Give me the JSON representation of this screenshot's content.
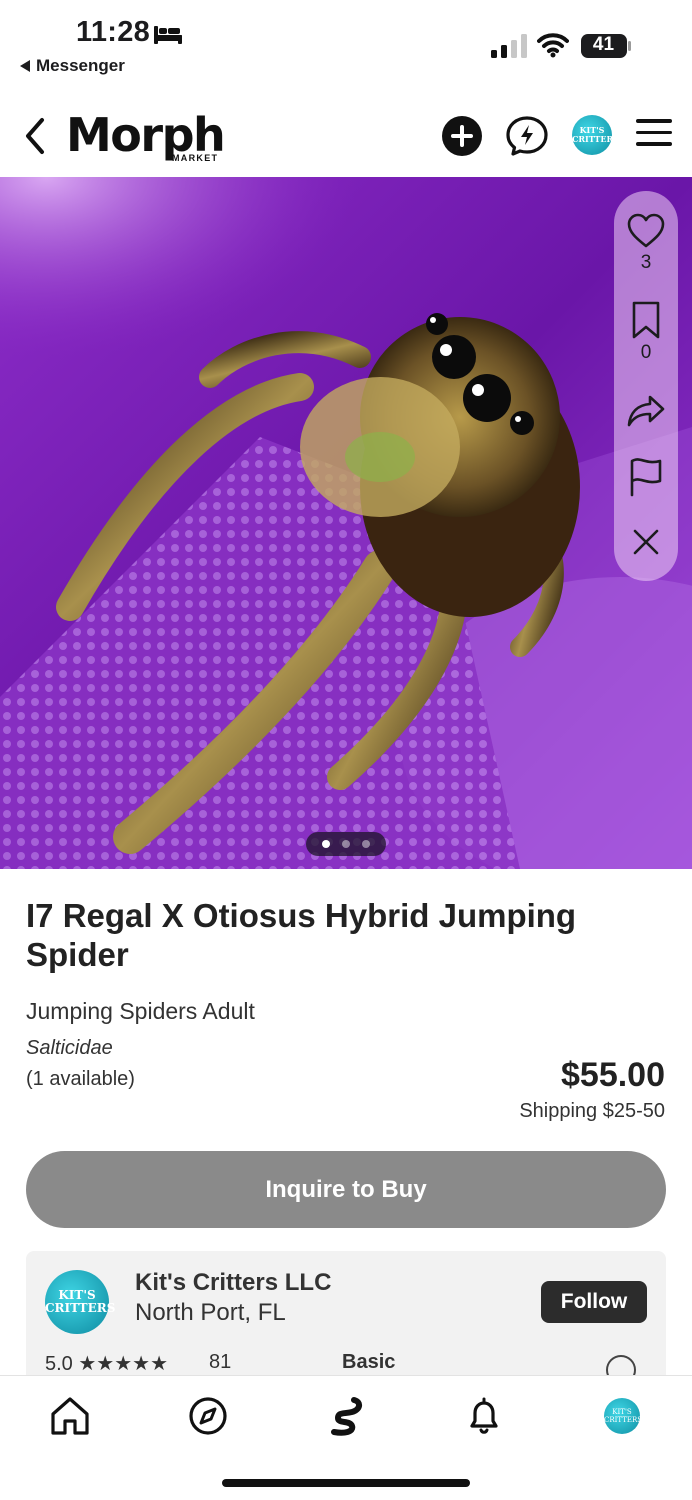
{
  "status_bar": {
    "time": "11:28",
    "back_app": "Messenger",
    "battery": "41",
    "icons": [
      "bed-icon",
      "signal-icon",
      "wifi-icon",
      "battery-icon"
    ]
  },
  "header": {
    "logo_text": "Morph",
    "logo_sub": "MARKET",
    "avatar_text": "KIT'S CRITTERS",
    "icons": [
      "back-chevron-icon",
      "plus-icon",
      "messenger-icon",
      "hamburger-menu-icon"
    ]
  },
  "hero": {
    "colors": {
      "background": "#7a1fb8",
      "rail": "#f0d2f5"
    },
    "actions": {
      "like_count": "3",
      "save_count": "0"
    },
    "icons": [
      "heart-icon",
      "bookmark-icon",
      "share-icon",
      "flag-icon",
      "close-icon"
    ],
    "carousel": {
      "total": 3,
      "active": 1
    }
  },
  "listing": {
    "title": "I7 Regal X Otiosus Hybrid Jumping Spider",
    "category": "Jumping Spiders Adult",
    "species": "Salticidae",
    "availability": "(1 available)",
    "price": "$55.00",
    "shipping": "Shipping $25-50",
    "cta_label": "Inquire to Buy"
  },
  "seller": {
    "avatar_text": "KIT'S CRITTERS",
    "name": "Kit's Critters LLC",
    "location": "North Port, FL",
    "follow_label": "Follow",
    "rating": "5.0 ★★★★★",
    "reviews": "81",
    "tier": "Basic"
  },
  "bottom_nav": {
    "items": [
      "home-icon",
      "explore-compass-icon",
      "snake-icon",
      "bell-icon",
      "profile-avatar"
    ],
    "avatar_text": "KIT'S CRITTERS"
  }
}
